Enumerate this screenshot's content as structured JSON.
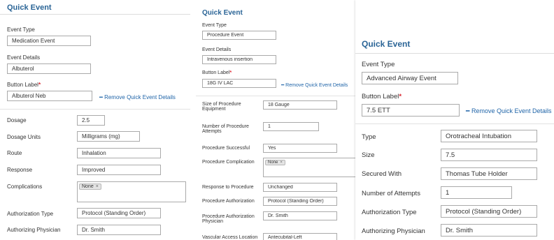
{
  "panel1": {
    "title": "Quick Event",
    "event_type_label": "Event Type",
    "event_type_value": "Medication Event",
    "event_details_label": "Event Details",
    "event_details_value": "Albuterol",
    "button_label_label": "Button Label",
    "required_mark": "*",
    "button_label_value": "Albuterol Neb",
    "remove_link": "Remove Quick Event Details",
    "fields": [
      {
        "label": "Dosage",
        "value": "2.5"
      },
      {
        "label": "Dosage Units",
        "value": "Milligrams (mg)"
      },
      {
        "label": "Route",
        "value": "Inhalation"
      },
      {
        "label": "Response",
        "value": "Improved"
      },
      {
        "label": "Complications",
        "tag": "None"
      },
      {
        "label": "Authorization Type",
        "value": "Protocol (Standing Order)"
      },
      {
        "label": "Authorizing Physician",
        "value": "Dr. Smith"
      }
    ]
  },
  "panel2": {
    "title": "Quick Event",
    "event_type_label": "Event Type",
    "event_type_value": "Procedure Event",
    "event_details_label": "Event Details",
    "event_details_value": "Intravenous insertion",
    "button_label_label": "Button Label",
    "required_mark": "*",
    "button_label_value": "18G IV LAC",
    "remove_link": "Remove Quick Event Details",
    "fields": [
      {
        "label_lines": [
          "Size of Procedure",
          "Equipment"
        ],
        "value": "18 Gauge"
      },
      {
        "label_lines": [
          "Number of Procedure",
          "Attempts"
        ],
        "value": "1"
      },
      {
        "label_lines": [
          "Procedure Successful"
        ],
        "value": "Yes"
      },
      {
        "label_lines": [
          "Procedure Complication"
        ],
        "tag": "None"
      },
      {
        "label_lines": [
          "Response to Procedure"
        ],
        "value": "Unchanged"
      },
      {
        "label_lines": [
          "Procedure Authorization"
        ],
        "value": "Protocol (Standing Order)"
      },
      {
        "label_lines": [
          "Procedure Authorization",
          "Physician"
        ],
        "value": "Dr. Smith"
      },
      {
        "label_lines": [
          "Vascular Access Location"
        ],
        "value": "Antecubital-Left"
      }
    ]
  },
  "panel3": {
    "title": "Quick Event",
    "event_type_label": "Event Type",
    "event_type_value": "Advanced Airway Event",
    "button_label_label": "Button Label",
    "required_mark": "*",
    "button_label_value": "7.5 ETT",
    "remove_link": "Remove Quick Event Details",
    "fields": [
      {
        "label": "Type",
        "value": "Orotracheal Intubation"
      },
      {
        "label": "Size",
        "value": "7.5"
      },
      {
        "label": "Secured With",
        "value": "Thomas Tube Holder"
      },
      {
        "label": "Number of Attempts",
        "value": "1"
      },
      {
        "label": "Authorization Type",
        "value": "Protocol (Standing Order)"
      },
      {
        "label": "Authorizing Physician",
        "value": "Dr. Smith"
      }
    ]
  },
  "icons": {
    "remove": "minus-icon",
    "tag_remove": "close-icon"
  },
  "colors": {
    "title": "#2a6496",
    "link": "#1f64a8",
    "required": "#d9232d"
  }
}
